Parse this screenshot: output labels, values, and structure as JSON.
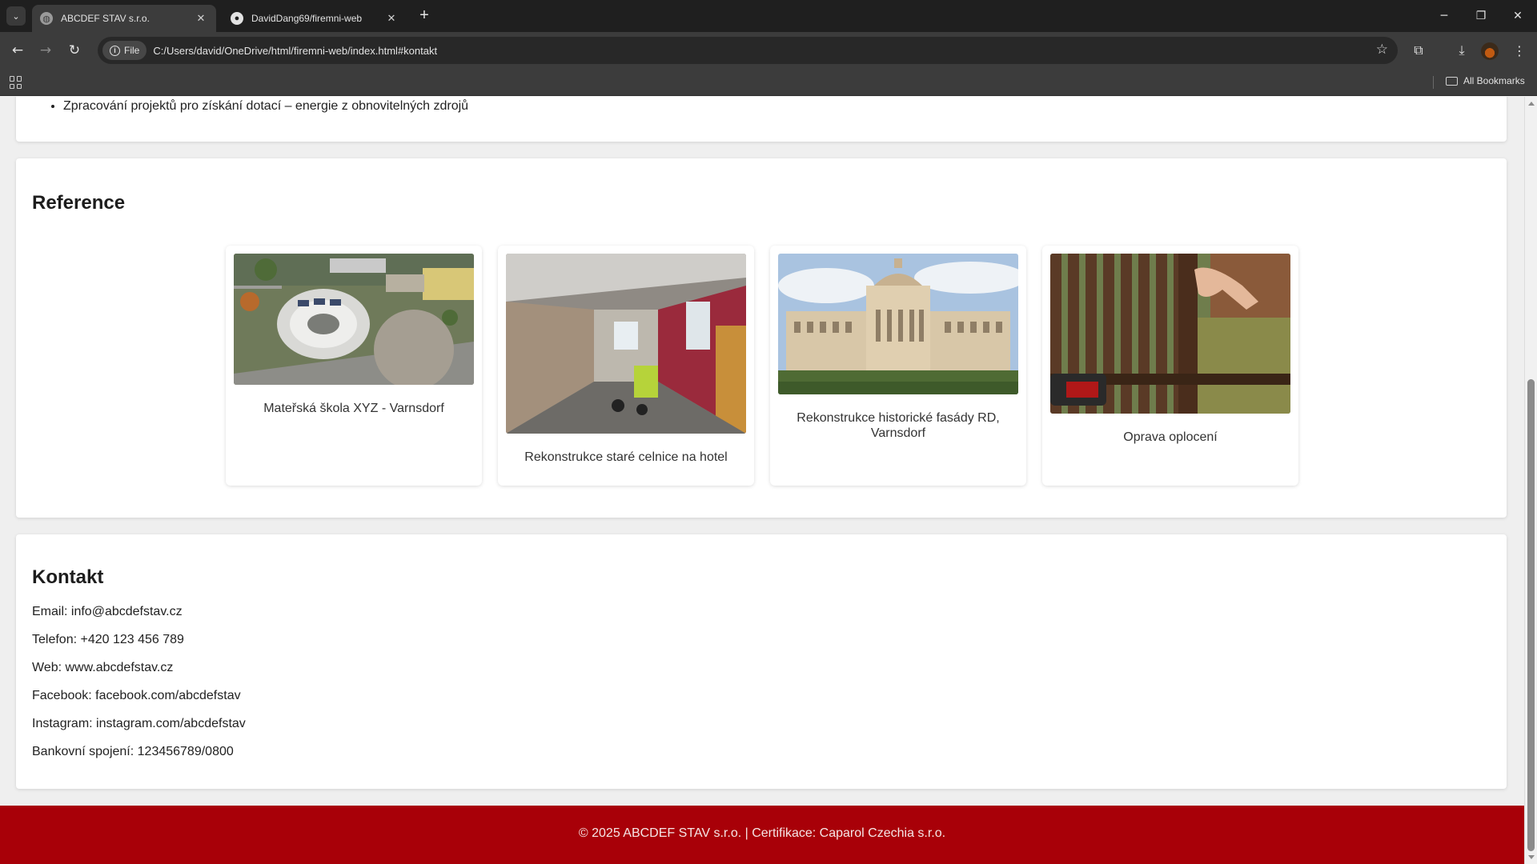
{
  "browser": {
    "tabs": [
      {
        "title": "ABCDEF STAV s.r.o.",
        "active": true
      },
      {
        "title": "DavidDang69/firemni-web",
        "active": false
      }
    ],
    "address": {
      "chip_label": "File",
      "url": "C:/Users/david/OneDrive/html/firemni-web/index.html#kontakt"
    },
    "bookmarks_label": "All Bookmarks"
  },
  "services": {
    "items": [
      "Zpracování projektů pro získání dotací – energie z obnovitelných zdrojů"
    ]
  },
  "reference": {
    "title": "Reference",
    "items": [
      {
        "caption": "Mateřská škola XYZ - Varnsdorf"
      },
      {
        "caption": "Rekonstrukce staré celnice na hotel"
      },
      {
        "caption": "Rekonstrukce historické fasády RD, Varnsdorf"
      },
      {
        "caption": "Oprava oplocení"
      }
    ]
  },
  "contact": {
    "title": "Kontakt",
    "email": "Email: info@abcdefstav.cz",
    "phone": "Telefon: +420 123 456 789",
    "web": "Web: www.abcdefstav.cz",
    "facebook": "Facebook: facebook.com/abcdefstav",
    "instagram": "Instagram: instagram.com/abcdefstav",
    "bank": "Bankovní spojení: 123456789/0800"
  },
  "footer": {
    "text": "© 2025 ABCDEF STAV s.r.o. | Certifikace: Caparol Czechia s.r.o."
  },
  "colors": {
    "footer_bg": "#a80008",
    "page_bg": "#efefef",
    "chrome_dark": "#1f1f1f",
    "chrome_toolbar": "#3c3c3c"
  }
}
